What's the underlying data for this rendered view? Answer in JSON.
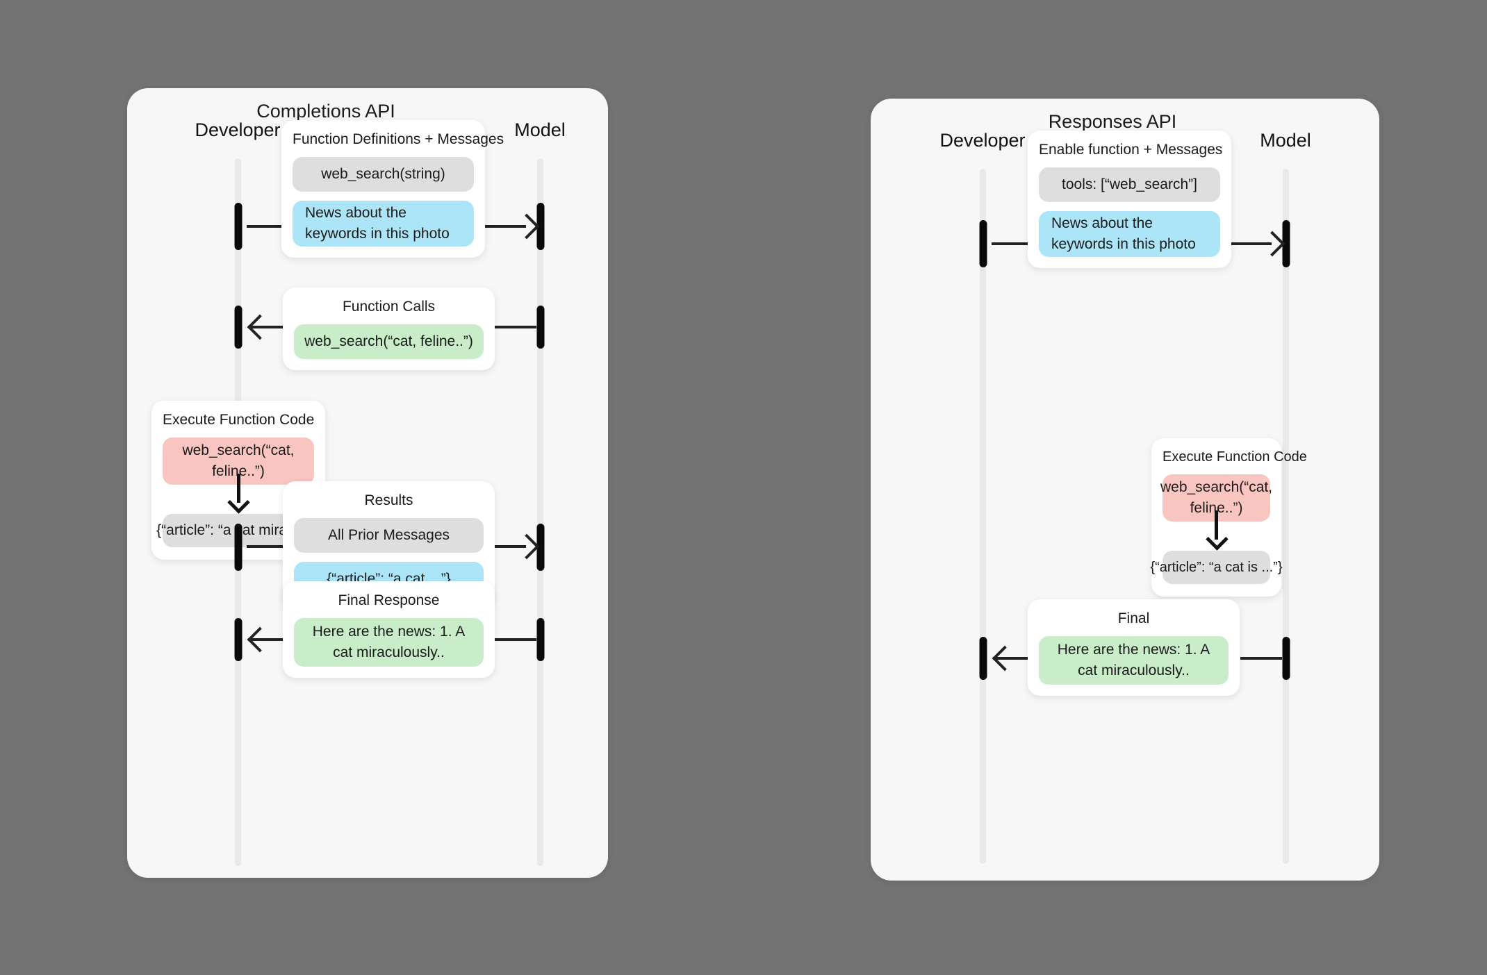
{
  "page": {
    "background_color": "#737373",
    "panel_background_color": "#f7f7f7"
  },
  "colors": {
    "chip_gray": "#dedede",
    "chip_blue": "#ace5f7",
    "chip_green": "#c9ecc9",
    "chip_red": "#f9c5c0",
    "activation_bar": "#0a0a0a",
    "lifeline": "#e9e9e9"
  },
  "panels": [
    {
      "id": "completions",
      "title": "Completions API",
      "actor_left": "Developer",
      "actor_right": "Model",
      "steps": [
        {
          "id": "function-definitions",
          "title": "Function Definitions + Messages",
          "direction": "right",
          "chips": [
            {
              "text": "web_search(string)",
              "color": "gray"
            },
            {
              "text": "News about the keywords in this photo",
              "color": "blue"
            }
          ]
        },
        {
          "id": "function-calls",
          "title": "Function Calls",
          "direction": "left",
          "chips": [
            {
              "text": "web_search(“cat, feline..”)",
              "color": "green"
            }
          ]
        },
        {
          "id": "execute-function-code",
          "title": "Execute Function Code",
          "direction": "none",
          "chips": [
            {
              "text": "web_search(“cat, feline..”)",
              "color": "red"
            },
            {
              "text": "{“article”: “a cat mirac ...”}",
              "color": "gray"
            }
          ]
        },
        {
          "id": "results",
          "title": "Results",
          "direction": "right",
          "chips": [
            {
              "text": "All Prior Messages",
              "color": "gray"
            },
            {
              "text": "{“article”: “a cat  ...”}",
              "color": "blue"
            }
          ]
        },
        {
          "id": "final-response",
          "title": "Final Response",
          "direction": "left",
          "chips": [
            {
              "text": "Here are the news: 1. A cat miraculously..",
              "color": "green"
            }
          ]
        }
      ]
    },
    {
      "id": "responses",
      "title": "Responses API",
      "actor_left": "Developer",
      "actor_right": "Model",
      "steps": [
        {
          "id": "enable-function",
          "title": "Enable function + Messages",
          "direction": "right",
          "chips": [
            {
              "text": "tools: [“web_search”]",
              "color": "gray"
            },
            {
              "text": "News about the keywords in this photo",
              "color": "blue"
            }
          ]
        },
        {
          "id": "execute-function-code",
          "title": "Execute Function Code",
          "direction": "none",
          "chips": [
            {
              "text": "web_search(“cat, feline..”)",
              "color": "red"
            },
            {
              "text": "{“article”: “a cat is ...”}",
              "color": "gray"
            }
          ]
        },
        {
          "id": "final",
          "title": "Final",
          "direction": "left",
          "chips": [
            {
              "text": "Here are the news: 1. A cat miraculously..",
              "color": "green"
            }
          ]
        }
      ]
    }
  ]
}
